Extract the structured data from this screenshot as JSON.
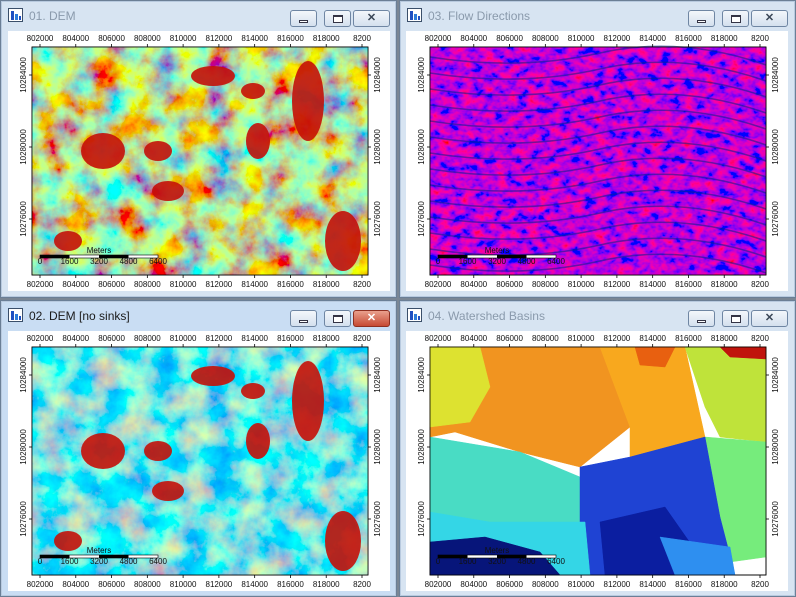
{
  "windows": [
    {
      "title": "01. DEM",
      "active": false,
      "map": "dem",
      "scalebar": true
    },
    {
      "title": "03. Flow Directions",
      "active": false,
      "map": "flow",
      "scalebar": true
    },
    {
      "title": "02. DEM [no sinks]",
      "active": true,
      "map": "filled",
      "scalebar": true
    },
    {
      "title": "04. Watershed Basins",
      "active": false,
      "map": "basins",
      "scalebar": true
    }
  ],
  "axes": {
    "x_ticks": [
      "802000",
      "804000",
      "806000",
      "808000",
      "810000",
      "812000",
      "814000",
      "816000",
      "818000",
      "8200"
    ],
    "y_ticks": [
      "10284000",
      "10280000",
      "10276000"
    ]
  },
  "scalebar": {
    "unit_label": "Meters",
    "labels": [
      "0",
      "1600",
      "3200",
      "4800",
      "6400"
    ]
  },
  "icons": {
    "app": "map-window-icon",
    "minimize": "minimize-icon",
    "maximize": "maximize-icon",
    "close": "close-icon"
  }
}
